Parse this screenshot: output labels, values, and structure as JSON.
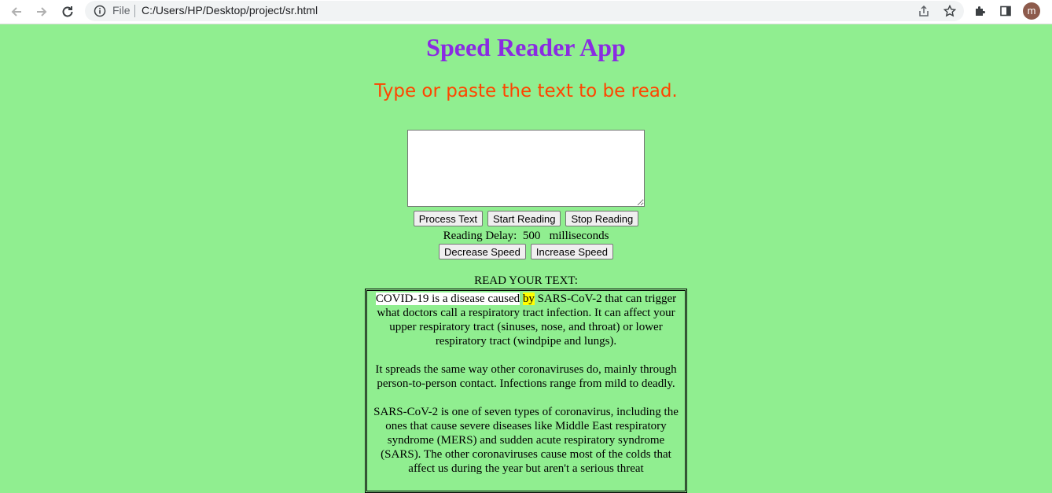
{
  "browser": {
    "file_label": "File",
    "url": "C:/Users/HP/Desktop/project/sr.html",
    "avatar_letter": "m"
  },
  "app": {
    "title": "Speed Reader App",
    "subtitle": "Type or paste the text to be read.",
    "textarea_value": "",
    "buttons": {
      "process": "Process Text",
      "start": "Start Reading",
      "stop": "Stop Reading",
      "decrease": "Decrease Speed",
      "increase": "Increase Speed"
    },
    "delay": {
      "label": "Reading Delay:",
      "value": "500",
      "unit": "milliseconds"
    },
    "read_label": "READ YOUR TEXT:",
    "reader": {
      "p1_before": "COVID-19 is a disease caused",
      "p1_current": "by",
      "p1_after": "SARS-CoV-2 that can trigger what doctors call a respiratory tract infection. It can affect your upper respiratory tract (sinuses, nose, and throat) or lower respiratory tract (windpipe and lungs).",
      "p2": "It spreads the same way other coronaviruses do, mainly through person-to-person contact. Infections range from mild to deadly.",
      "p3": "SARS-CoV-2 is one of seven types of coronavirus, including the ones that cause severe diseases like Middle East respiratory syndrome (MERS) and sudden acute respiratory syndrome (SARS). The other coronaviruses cause most of the colds that affect us during the year but aren't a serious threat"
    }
  },
  "colors": {
    "page_bg": "#90ee90",
    "title": "#8a2be2",
    "subtitle": "#ff4500",
    "highlight": "#ffff00"
  }
}
